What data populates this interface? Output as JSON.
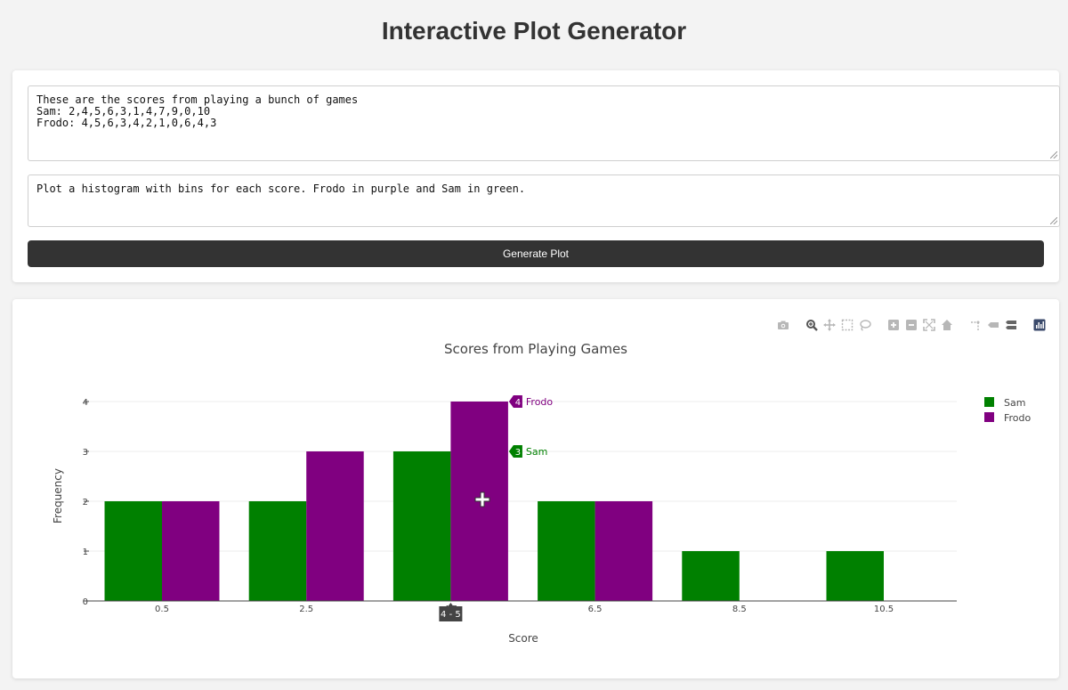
{
  "page": {
    "title": "Interactive Plot Generator"
  },
  "inputs": {
    "data_text": "These are the scores from playing a bunch of games\nSam: 2,4,5,6,3,1,4,7,9,0,10\nFrodo: 4,5,6,3,4,2,1,0,6,4,3",
    "prompt_text": "Plot a histogram with bins for each score. Frodo in purple and Sam in green.",
    "generate_label": "Generate Plot"
  },
  "modebar": {
    "icons": [
      "camera-icon",
      "zoom-icon",
      "pan-icon",
      "box-select-icon",
      "lasso-icon",
      "zoom-in-icon",
      "zoom-out-icon",
      "autoscale-icon",
      "reset-axes-icon",
      "spike-lines-icon",
      "hover-closest-icon",
      "hover-compare-icon",
      "plotly-logo-icon"
    ]
  },
  "chart_data": {
    "type": "bar",
    "title": "Scores from Playing Games",
    "xlabel": "Score",
    "ylabel": "Frequency",
    "x_ticks": [
      "0.5",
      "2.5",
      "4.5",
      "6.5",
      "8.5",
      "10.5"
    ],
    "x_tick_hover_label": "4 - 5",
    "y_ticks": [
      0,
      1,
      2,
      3,
      4
    ],
    "ylim": [
      0,
      4.4
    ],
    "grid": true,
    "legend_position": "top-right",
    "bins": [
      "0-1",
      "2-3",
      "4-5",
      "6-7",
      "8-9",
      "10-11"
    ],
    "series": [
      {
        "name": "Sam",
        "color": "#008000",
        "values": [
          2,
          2,
          3,
          2,
          1,
          1
        ]
      },
      {
        "name": "Frodo",
        "color": "#800080",
        "values": [
          2,
          3,
          4,
          2,
          0,
          0
        ]
      }
    ],
    "hover": {
      "bin_index": 2,
      "labels": [
        {
          "series": "Frodo",
          "value": "4"
        },
        {
          "series": "Sam",
          "value": "3"
        }
      ]
    }
  }
}
